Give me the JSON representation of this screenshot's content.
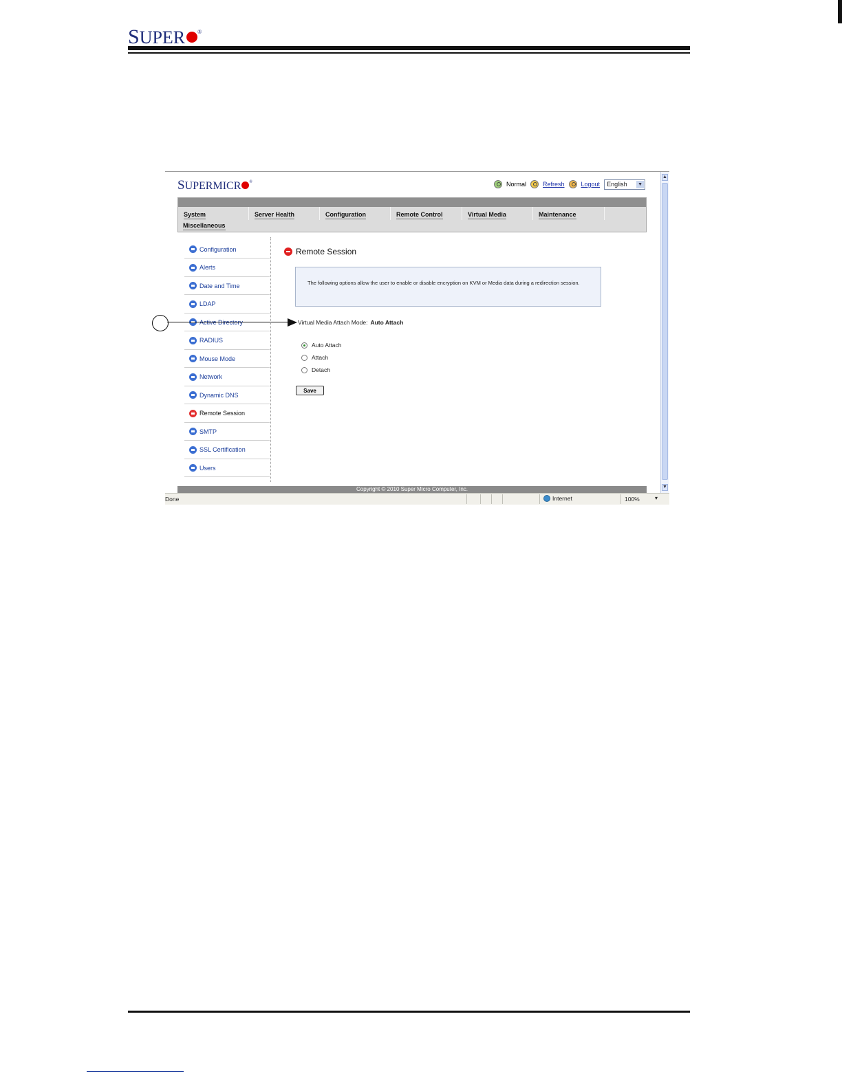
{
  "doc": {
    "logo_first": "S",
    "logo_rest": "UPER",
    "logo_reg": "®"
  },
  "app": {
    "logo_first": "S",
    "logo_rest": "UPERMICR",
    "logo_reg": "®",
    "status_label": "Normal",
    "refresh_label": "Refresh",
    "logout_label": "Logout",
    "language_value": "English",
    "nav": {
      "tabs": [
        "System",
        "Server Health",
        "Configuration",
        "Remote Control",
        "Virtual Media",
        "Maintenance",
        "Miscellaneous"
      ]
    },
    "sidebar": {
      "items": [
        "Configuration",
        "Alerts",
        "Date and Time",
        "LDAP",
        "Active Directory",
        "RADIUS",
        "Mouse Mode",
        "Network",
        "Dynamic DNS",
        "Remote Session",
        "SMTP",
        "SSL Certification",
        "Users"
      ],
      "active": "Remote Session"
    },
    "main": {
      "title": "Remote Session",
      "info_text": "The following options allow the user to enable or disable encryption on KVM or Media data during a redirection session.",
      "attach_mode_label": "Virtual Media Attach Mode:",
      "attach_mode_value": "Auto Attach",
      "options": [
        "Auto Attach",
        "Attach",
        "Detach"
      ],
      "selected_option": "Auto Attach",
      "save_label": "Save"
    },
    "copyright": "Copyright © 2010 Super Micro Computer, Inc.",
    "status_bar": {
      "done": "Done",
      "zone": "Internet",
      "zoom": "100%"
    }
  },
  "colors": {
    "brand_blue": "#1f2d7a",
    "brand_red": "#e00000",
    "link_blue": "#1a3d9a"
  }
}
